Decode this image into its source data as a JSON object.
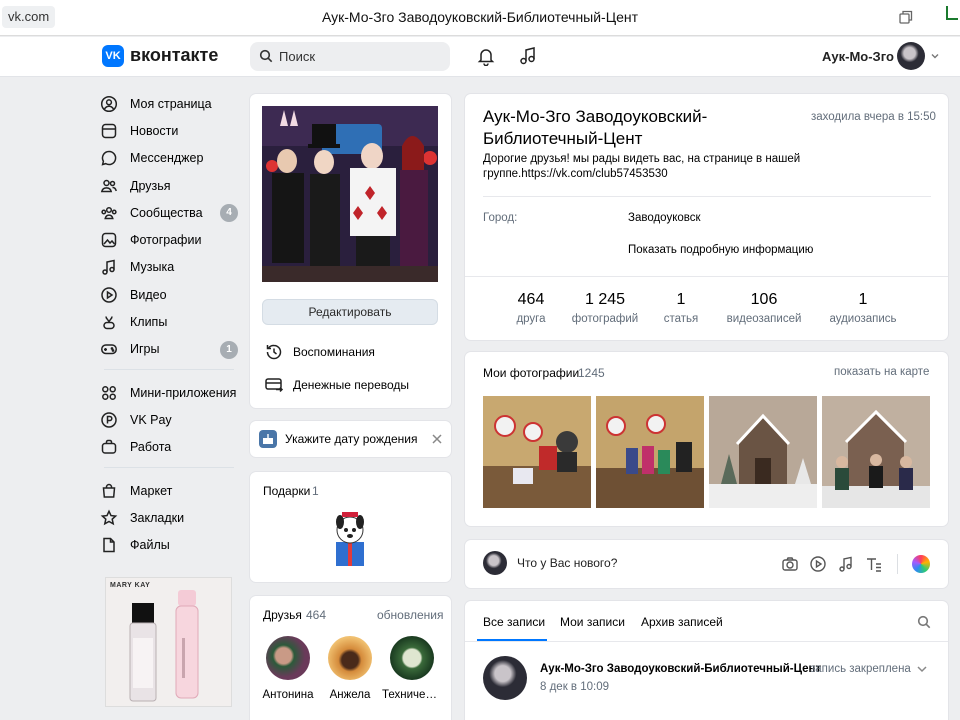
{
  "browser": {
    "url": "vk.com",
    "title": "Аук-Мо-Зго Заводоуковский-Библиотечный-Цент"
  },
  "header": {
    "logo_mark": "VK",
    "logo_text": "вконтакте",
    "search_placeholder": "Поиск",
    "user_name": "Аук-Мо-Зго"
  },
  "sidebar": {
    "items": [
      {
        "label": "Моя страница",
        "icon": "user-circle-icon"
      },
      {
        "label": "Новости",
        "icon": "news-icon"
      },
      {
        "label": "Мессенджер",
        "icon": "message-icon"
      },
      {
        "label": "Друзья",
        "icon": "friends-icon"
      },
      {
        "label": "Сообщества",
        "icon": "communities-icon",
        "badge": "4"
      },
      {
        "label": "Фотографии",
        "icon": "photo-icon"
      },
      {
        "label": "Музыка",
        "icon": "music-note-icon"
      },
      {
        "label": "Видео",
        "icon": "play-icon"
      },
      {
        "label": "Клипы",
        "icon": "clips-icon"
      },
      {
        "label": "Игры",
        "icon": "gamepad-icon",
        "badge": "1"
      }
    ],
    "items2": [
      {
        "label": "Мини-приложения",
        "icon": "apps-icon"
      },
      {
        "label": "VK Pay",
        "icon": "vkpay-icon"
      },
      {
        "label": "Работа",
        "icon": "briefcase-icon"
      }
    ],
    "items3": [
      {
        "label": "Маркет",
        "icon": "bag-icon"
      },
      {
        "label": "Закладки",
        "icon": "star-icon"
      },
      {
        "label": "Файлы",
        "icon": "file-icon"
      }
    ],
    "ad_brand": "MARY KAY"
  },
  "profile": {
    "edit_label": "Редактировать",
    "memories_label": "Воспоминания",
    "transfers_label": "Денежные переводы",
    "birthday_prompt": "Укажите дату рождения",
    "gifts_label": "Подарки",
    "gifts_count": "1",
    "name_line1": "Аук-Мо-Зго Заводоуковский-",
    "name_line2": "Библиотечный-Цент",
    "last_seen": "заходила вчера в 15:50",
    "status_line1": "Дорогие друзья! мы рады видеть вас, на странице в нашей",
    "status_line2": "группе.https://vk.com/club57453530",
    "city_label": "Город:",
    "city_value": "Заводоуковск",
    "more_info": "Показать подробную информацию",
    "stats": [
      {
        "value": "464",
        "label": "друга"
      },
      {
        "value": "1 245",
        "label": "фотографий"
      },
      {
        "value": "1",
        "label": "статья"
      },
      {
        "value": "106",
        "label": "видеозаписей"
      },
      {
        "value": "1",
        "label": "аудиозапись"
      }
    ]
  },
  "photos": {
    "title": "Мои фотографии",
    "count": "1245",
    "map_link": "показать на карте"
  },
  "friends": {
    "title": "Друзья",
    "count": "464",
    "updates_link": "обновления",
    "list": [
      {
        "name": "Антонина"
      },
      {
        "name": "Анжела"
      },
      {
        "name": "Техническ..."
      }
    ]
  },
  "composer": {
    "placeholder": "Что у Вас нового?"
  },
  "wall": {
    "tabs": [
      "Все записи",
      "Мои записи",
      "Архив записей"
    ],
    "post_author": "Аук-Мо-Зго Заводоуковский-Библиотечный-Цент",
    "post_pinned": "запись закреплена",
    "post_date": "8 дек в 10:09"
  },
  "colors": {
    "accent": "#0077ff",
    "page_bg": "#edeef0",
    "text_secondary": "#626d7a",
    "badge_bg": "#a7adb3"
  }
}
